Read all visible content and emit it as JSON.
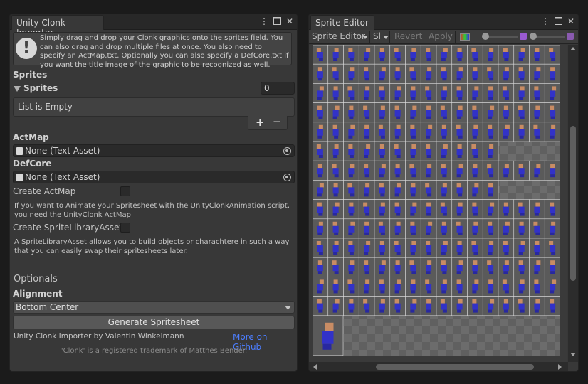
{
  "importer": {
    "tab_title": "Unity Clonk Importer",
    "help_text": "Simply drag and drop your Clonk graphics onto the sprites field. You can also drag and drop multiple files at once. You also need to specify an ActMap.txt. Optionally you can also specify a DefCore.txt if you want the title image of the graphic to be recognized as well.",
    "help_icon": "!",
    "sprites_heading": "Sprites",
    "sprites_foldout_label": "Sprites",
    "sprites_count": "0",
    "list_empty_text": "List is Empty",
    "add_symbol": "+",
    "remove_symbol": "−",
    "actmap_label": "ActMap",
    "actmap_value": "None (Text Asset)",
    "defcore_label": "DefCore",
    "defcore_value": "None (Text Asset)",
    "create_actmap_label": "Create ActMap",
    "create_actmap_desc": "If you want to Animate your Spritesheet with the UnityClonkAnimation script, you need the UnityClonk ActMap",
    "create_spritelib_label": "Create SpriteLibraryAsset",
    "create_spritelib_desc": "A SpriteLibraryAsset allows you to build objects or charachtere in such a way that you can easily swap their spritesheets later.",
    "optionals_label": "Optionals",
    "alignment_label": "Alignment",
    "alignment_value": "Bottom Center",
    "generate_button": "Generate Spritesheet",
    "credit_text": "Unity Clonk Importer by Valentin Winkelmann",
    "github_link": "More on Github",
    "trademark_text": "'Clonk' is a registered trademark of Matthes Bender."
  },
  "sprite_editor": {
    "tab_title": "Sprite Editor",
    "mode_dropdown": "Sprite Editor",
    "slice_dropdown": "Sl",
    "revert_button": "Revert",
    "apply_button": "Apply",
    "sheet_rows": [
      16,
      16,
      16,
      16,
      16,
      12,
      16,
      12,
      16,
      16,
      16,
      16,
      16,
      16,
      1
    ]
  },
  "colors": {
    "accent_link": "#4c7eff",
    "clonk_body": "#3232c8",
    "clonk_face": "#c88c64"
  },
  "icons": {
    "menu": "kebab-menu-icon",
    "maximize": "maximize-icon",
    "close": "close-icon",
    "help": "warning-icon",
    "text_asset": "text-asset-icon",
    "object_picker": "object-picker-icon",
    "dropdown": "chevron-down-icon"
  }
}
